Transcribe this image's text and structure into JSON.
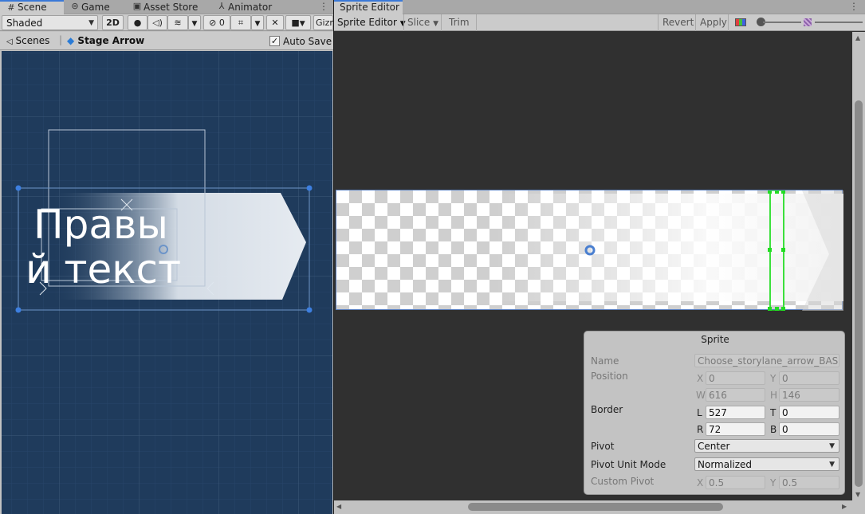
{
  "scene_panel": {
    "tabs": [
      {
        "label": "Scene",
        "icon": "grid-icon"
      },
      {
        "label": "Game",
        "icon": "gamepad-icon"
      },
      {
        "label": "Asset Store",
        "icon": "store-icon"
      },
      {
        "label": "Animator",
        "icon": "animator-icon"
      }
    ],
    "toolbar": {
      "shading_mode": "Shaded",
      "mode_2d_label": "2D",
      "hidden_count": "0",
      "gizmos_label": "Gizm"
    },
    "breadcrumb": {
      "scenes_label": "Scenes",
      "prefab_label": "Stage Arrow",
      "auto_save_label": "Auto Save",
      "auto_save_checked": true
    },
    "scene_text": {
      "line1": "Правы",
      "line2": "й текст"
    }
  },
  "sprite_editor": {
    "tab_label": "Sprite Editor",
    "toolbar": {
      "mode_label": "Sprite Editor",
      "slice_label": "Slice",
      "trim_label": "Trim",
      "revert_label": "Revert",
      "apply_label": "Apply"
    },
    "sprite_panel": {
      "title": "Sprite",
      "name_label": "Name",
      "name_value": "Choose_storylane_arrow_BASE",
      "position_label": "Position",
      "x_label": "X",
      "x_value": "0",
      "y_label": "Y",
      "y_value": "0",
      "w_label": "W",
      "w_value": "616",
      "h_label": "H",
      "h_value": "146",
      "border_label": "Border",
      "l_label": "L",
      "l_value": "527",
      "t_label": "T",
      "t_value": "0",
      "r_label": "R",
      "r_value": "72",
      "b_label": "B",
      "b_value": "0",
      "pivot_label": "Pivot",
      "pivot_value": "Center",
      "pivot_unit_label": "Pivot Unit Mode",
      "pivot_unit_value": "Normalized",
      "custom_pivot_label": "Custom Pivot",
      "cp_x_label": "X",
      "cp_x_value": "0.5",
      "cp_y_label": "Y",
      "cp_y_value": "0.5"
    }
  }
}
